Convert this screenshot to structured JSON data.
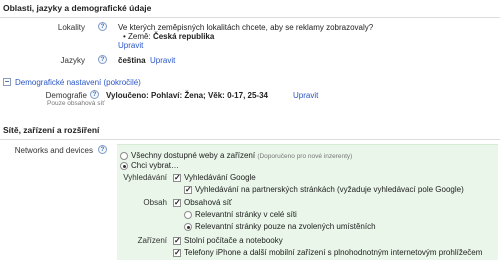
{
  "section1": {
    "title": "Oblasti, jazyky a demografické údaje",
    "locations": {
      "label": "Lokality",
      "question": "Ve kterých zeměpisných lokalitách chcete, aby se reklamy zobrazovaly?",
      "bullet_prefix": "Země:",
      "country": "Česká republika",
      "edit": "Upravit"
    },
    "languages": {
      "label": "Jazyky",
      "value": "čeština",
      "edit": "Upravit"
    },
    "demographic_toggle": {
      "symbol": "−",
      "label": "Demografické nastavení (pokročilé)"
    },
    "demographics": {
      "label": "Demografie",
      "sublabel": "Pouze obsahová síť",
      "value": "Vyloučeno: Pohlaví: Žena; Věk: 0-17, 25-34",
      "edit": "Upravit"
    }
  },
  "section2": {
    "title": "Sítě, zařízení a rozšíření",
    "networks": {
      "label": "Networks and devices",
      "option_all": "Všechny dostupné weby a zařízení",
      "option_all_note": "(Doporučeno pro nové inzerenty)",
      "option_choose": "Chci vybrat…",
      "selected_option": "Chci vybrat…",
      "search_label": "Vyhledávání",
      "search_google": "Vyhledávání Google",
      "search_partners": "Vyhledávání na partnerských stránkách (vyžaduje vyhledávací pole Google)",
      "content_label": "Obsah",
      "content_network": "Obsahová síť",
      "content_all_pages": "Relevantní stránky v celé síti",
      "content_managed": "Relevantní stránky pouze na zvolených umístěních",
      "devices_label": "Zařízení",
      "devices_desktop": "Stolní počítače a notebooky",
      "devices_mobile": "Telefony iPhone a další mobilní zařízení s plnohodnotným internetovým prohlížečem"
    }
  },
  "icons": {
    "help": "?",
    "check": "✓"
  }
}
